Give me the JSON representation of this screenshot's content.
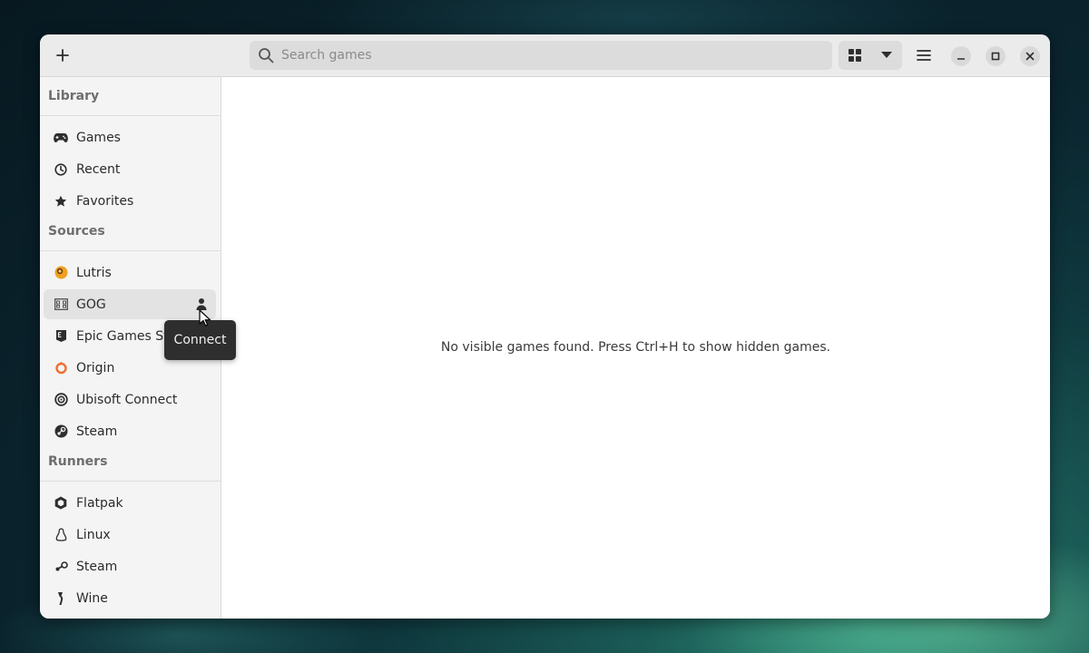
{
  "header": {
    "search_placeholder": "Search games"
  },
  "sidebar": {
    "library_header": "Library",
    "library": [
      {
        "label": "Games",
        "icon": "gamepad-icon"
      },
      {
        "label": "Recent",
        "icon": "clock-icon"
      },
      {
        "label": "Favorites",
        "icon": "star-icon"
      }
    ],
    "sources_header": "Sources",
    "sources": [
      {
        "label": "Lutris",
        "icon": "lutris-icon"
      },
      {
        "label": "GOG",
        "icon": "gog-icon",
        "selected": true
      },
      {
        "label": "Epic Games Store",
        "icon": "epic-icon"
      },
      {
        "label": "Origin",
        "icon": "origin-icon"
      },
      {
        "label": "Ubisoft Connect",
        "icon": "ubisoft-icon"
      },
      {
        "label": "Steam",
        "icon": "steam-icon"
      }
    ],
    "runners_header": "Runners",
    "runners": [
      {
        "label": "Flatpak",
        "icon": "flatpak-icon"
      },
      {
        "label": "Linux",
        "icon": "linux-icon"
      },
      {
        "label": "Steam",
        "icon": "steam-icon"
      },
      {
        "label": "Wine",
        "icon": "wine-icon"
      }
    ]
  },
  "tooltip": {
    "text": "Connect"
  },
  "main": {
    "empty_message": "No visible games found. Press Ctrl+H to show hidden games."
  },
  "colors": {
    "lutris_orange": "#f0a020",
    "origin_orange": "#f56c2d"
  }
}
